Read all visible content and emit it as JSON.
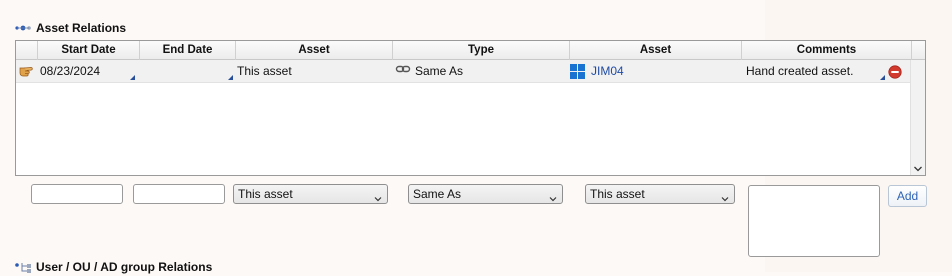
{
  "asset_relations": {
    "title": "Asset Relations",
    "columns": [
      "Start Date",
      "End Date",
      "Asset",
      "Type",
      "Asset",
      "Comments"
    ],
    "rows": [
      {
        "start_date": "08/23/2024",
        "end_date": "",
        "asset": "This asset",
        "type": "Same As",
        "related_asset": "JIM04",
        "comments": "Hand created asset."
      }
    ],
    "form": {
      "start_date": "",
      "end_date": "",
      "asset_select": "This asset",
      "type_select": "Same As",
      "asset2_select": "This asset",
      "comments": "",
      "add_label": "Add"
    }
  },
  "user_relations": {
    "title": "User / OU / AD group Relations"
  },
  "icons": {
    "row_pointer": "hand-pointer-icon",
    "type_icon": "chain-link-icon",
    "asset_icon": "windows-icon",
    "remove": "remove-icon"
  },
  "colors": {
    "link": "#1f4ba5",
    "remove": "#d23a2e",
    "add_text": "#2f63b4"
  }
}
